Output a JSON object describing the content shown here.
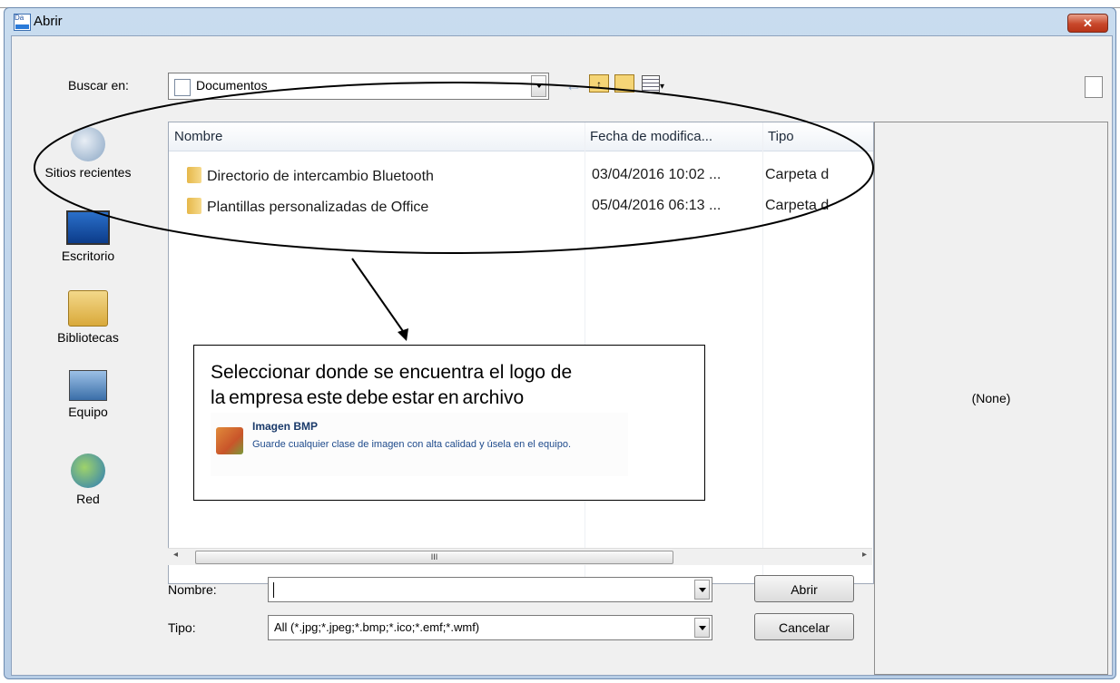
{
  "window": {
    "title": "Abrir",
    "close_glyph": "✕",
    "app_icon_text": "Da"
  },
  "lookin": {
    "label": "Buscar en:",
    "value": "Documentos"
  },
  "toolbar": {
    "back_icon": "back-arrow-icon",
    "up_icon": "up-folder-icon",
    "newfolder_icon": "new-folder-icon",
    "views_icon": "views-menu-icon"
  },
  "places": [
    {
      "label": "Sitios recientes",
      "icon": "recent-places-icon"
    },
    {
      "label": "Escritorio",
      "icon": "desktop-icon"
    },
    {
      "label": "Bibliotecas",
      "icon": "libraries-icon"
    },
    {
      "label": "Equipo",
      "icon": "computer-icon"
    },
    {
      "label": "Red",
      "icon": "network-icon"
    }
  ],
  "columns": {
    "name": "Nombre",
    "date": "Fecha de modifica...",
    "type": "Tipo"
  },
  "files": [
    {
      "name": "Directorio de intercambio Bluetooth",
      "date": "03/04/2016 10:02 ...",
      "type": "Carpeta d"
    },
    {
      "name": "Plantillas personalizadas de Office",
      "date": "05/04/2016 06:13 ...",
      "type": "Carpeta d"
    }
  ],
  "scroll": {
    "thumb_grip": "III"
  },
  "preview": {
    "text": "(None)"
  },
  "filename": {
    "label": "Nombre:",
    "value": ""
  },
  "filetype": {
    "label": "Tipo:",
    "value": "All (*.jpg;*.jpeg;*.bmp;*.ico;*.emf;*.wmf)"
  },
  "buttons": {
    "open": "Abrir",
    "cancel": "Cancelar"
  },
  "annotation": {
    "line1": "Seleccionar donde se encuentra el logo de",
    "line2": "la   empresa   este   debe   estar   en   archivo",
    "bmp_title": "Imagen BMP",
    "bmp_desc": "Guarde cualquier clase de imagen con alta calidad y úsela en el equipo."
  }
}
